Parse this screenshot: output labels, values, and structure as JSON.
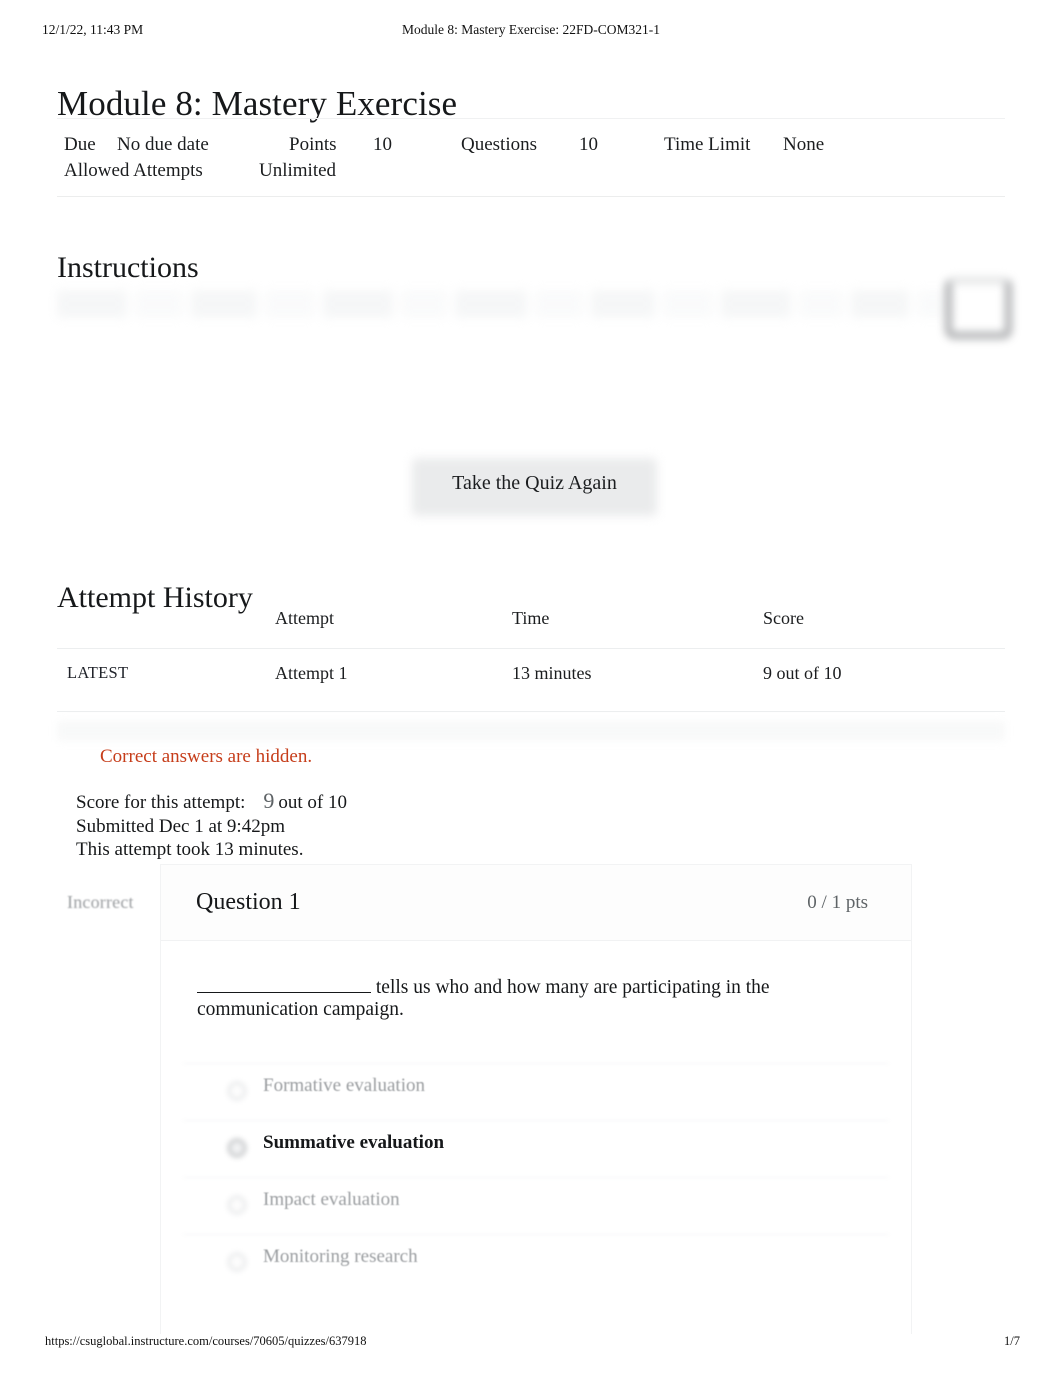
{
  "print_header": {
    "date": "12/1/22, 11:43 PM",
    "title": "Module 8: Mastery Exercise: 22FD-COM321-1"
  },
  "page_title": "Module 8: Mastery Exercise",
  "meta": {
    "due_label": "Due",
    "due_value": "No due date",
    "points_label": "Points",
    "points_value": "10",
    "questions_label": "Questions",
    "questions_value": "10",
    "time_limit_label": "Time Limit",
    "time_limit_value": "None",
    "allowed_attempts_label": "Allowed Attempts",
    "allowed_attempts_value": "Unlimited"
  },
  "instructions": {
    "heading": "Instructions"
  },
  "retake_button": {
    "label": "Take the Quiz Again"
  },
  "attempt_history": {
    "heading": "Attempt History",
    "columns": [
      "",
      "Attempt",
      "Time",
      "Score"
    ],
    "rows": [
      {
        "kept": "LATEST",
        "attempt": "Attempt 1",
        "time": "13 minutes",
        "score": "9 out of 10"
      }
    ]
  },
  "result_summary": {
    "hidden_note": "Correct answers are hidden.",
    "score_label": "Score for this attempt:",
    "score_value": "9",
    "score_suffix": "out of 10",
    "submitted": "Submitted Dec 1 at 9:42pm",
    "duration": "This attempt took 13 minutes."
  },
  "question": {
    "status": "Incorrect",
    "title": "Question 1",
    "points": "0 / 1 pts",
    "text_before_blank": "",
    "text_after_blank": " tells us who and how many are participating in the communication campaign.",
    "options": [
      {
        "label": "Formative evaluation",
        "selected": false
      },
      {
        "label": "Summative evaluation",
        "selected": true
      },
      {
        "label": "Impact evaluation",
        "selected": false
      },
      {
        "label": "Monitoring research",
        "selected": false
      }
    ]
  },
  "print_footer": {
    "url": "https://csuglobal.instructure.com/courses/70605/quizzes/637918",
    "page": "1/7"
  },
  "colors": {
    "accent_warning": "#c63d1a",
    "text_primary": "#16181a",
    "text_muted": "#9a9da0"
  }
}
